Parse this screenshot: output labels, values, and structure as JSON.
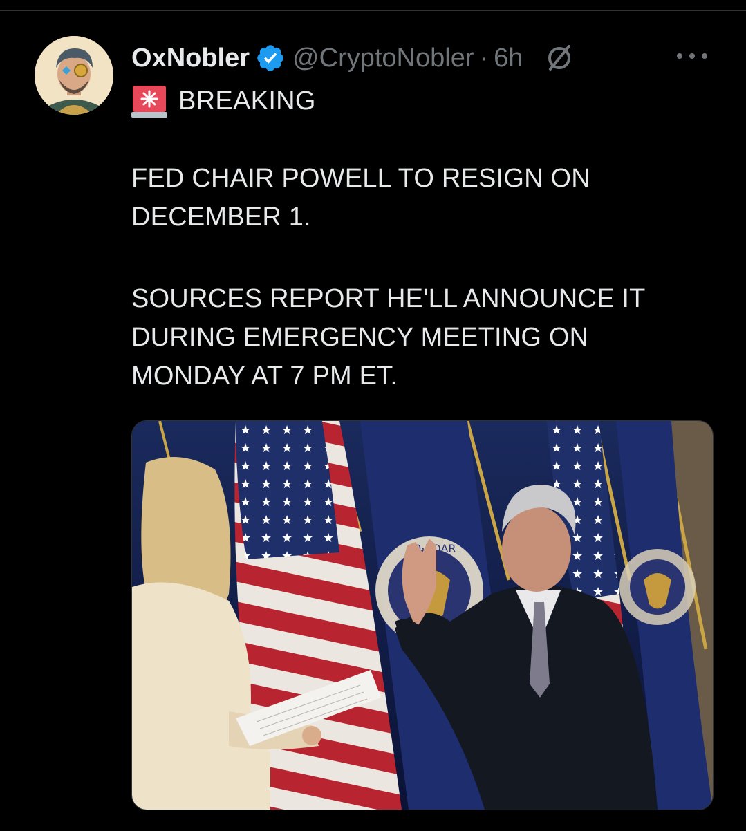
{
  "tweet": {
    "display_name": "OxNobler",
    "handle": "@CryptoNobler",
    "separator": "·",
    "time": "6h",
    "breaking_label": "BREAKING",
    "paragraph1": [
      "FED CHAIR POWELL TO RESIGN ON",
      "DECEMBER 1."
    ],
    "paragraph2": [
      "SOURCES REPORT HE'LL ANNOUNCE IT",
      "DURING EMERGENCY MEETING ON",
      "MONDAY AT 7 PM ET."
    ],
    "seal_text": "10·BOAR"
  },
  "icons": {
    "verified": "verified-badge-icon",
    "grok": "grok-icon",
    "more": "more-options-icon",
    "siren": "siren-emoji-icon"
  },
  "colors": {
    "background": "#000000",
    "text": "#e7e9ea",
    "secondary_text": "#71767b",
    "verified_blue": "#1d9bf0",
    "divider": "#2f3336"
  }
}
